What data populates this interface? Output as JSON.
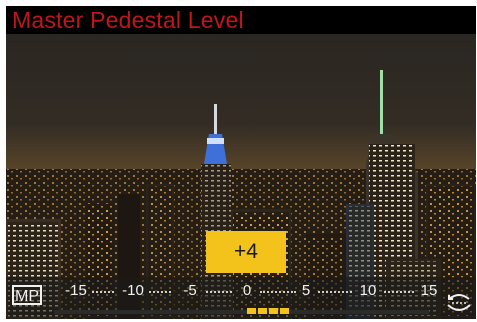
{
  "screen": {
    "title": "Master Pedestal Level"
  },
  "badge": {
    "label": "MP"
  },
  "value": {
    "display": "+4",
    "current": 4
  },
  "scale": {
    "min": -15,
    "max": 15,
    "ticks": [
      "-15",
      "-10",
      "-5",
      "0",
      "5",
      "10",
      "15"
    ]
  },
  "colors": {
    "title": "#c0161b",
    "accent": "#f3c21b"
  },
  "icons": {
    "dial": "rear-dial-icon"
  }
}
